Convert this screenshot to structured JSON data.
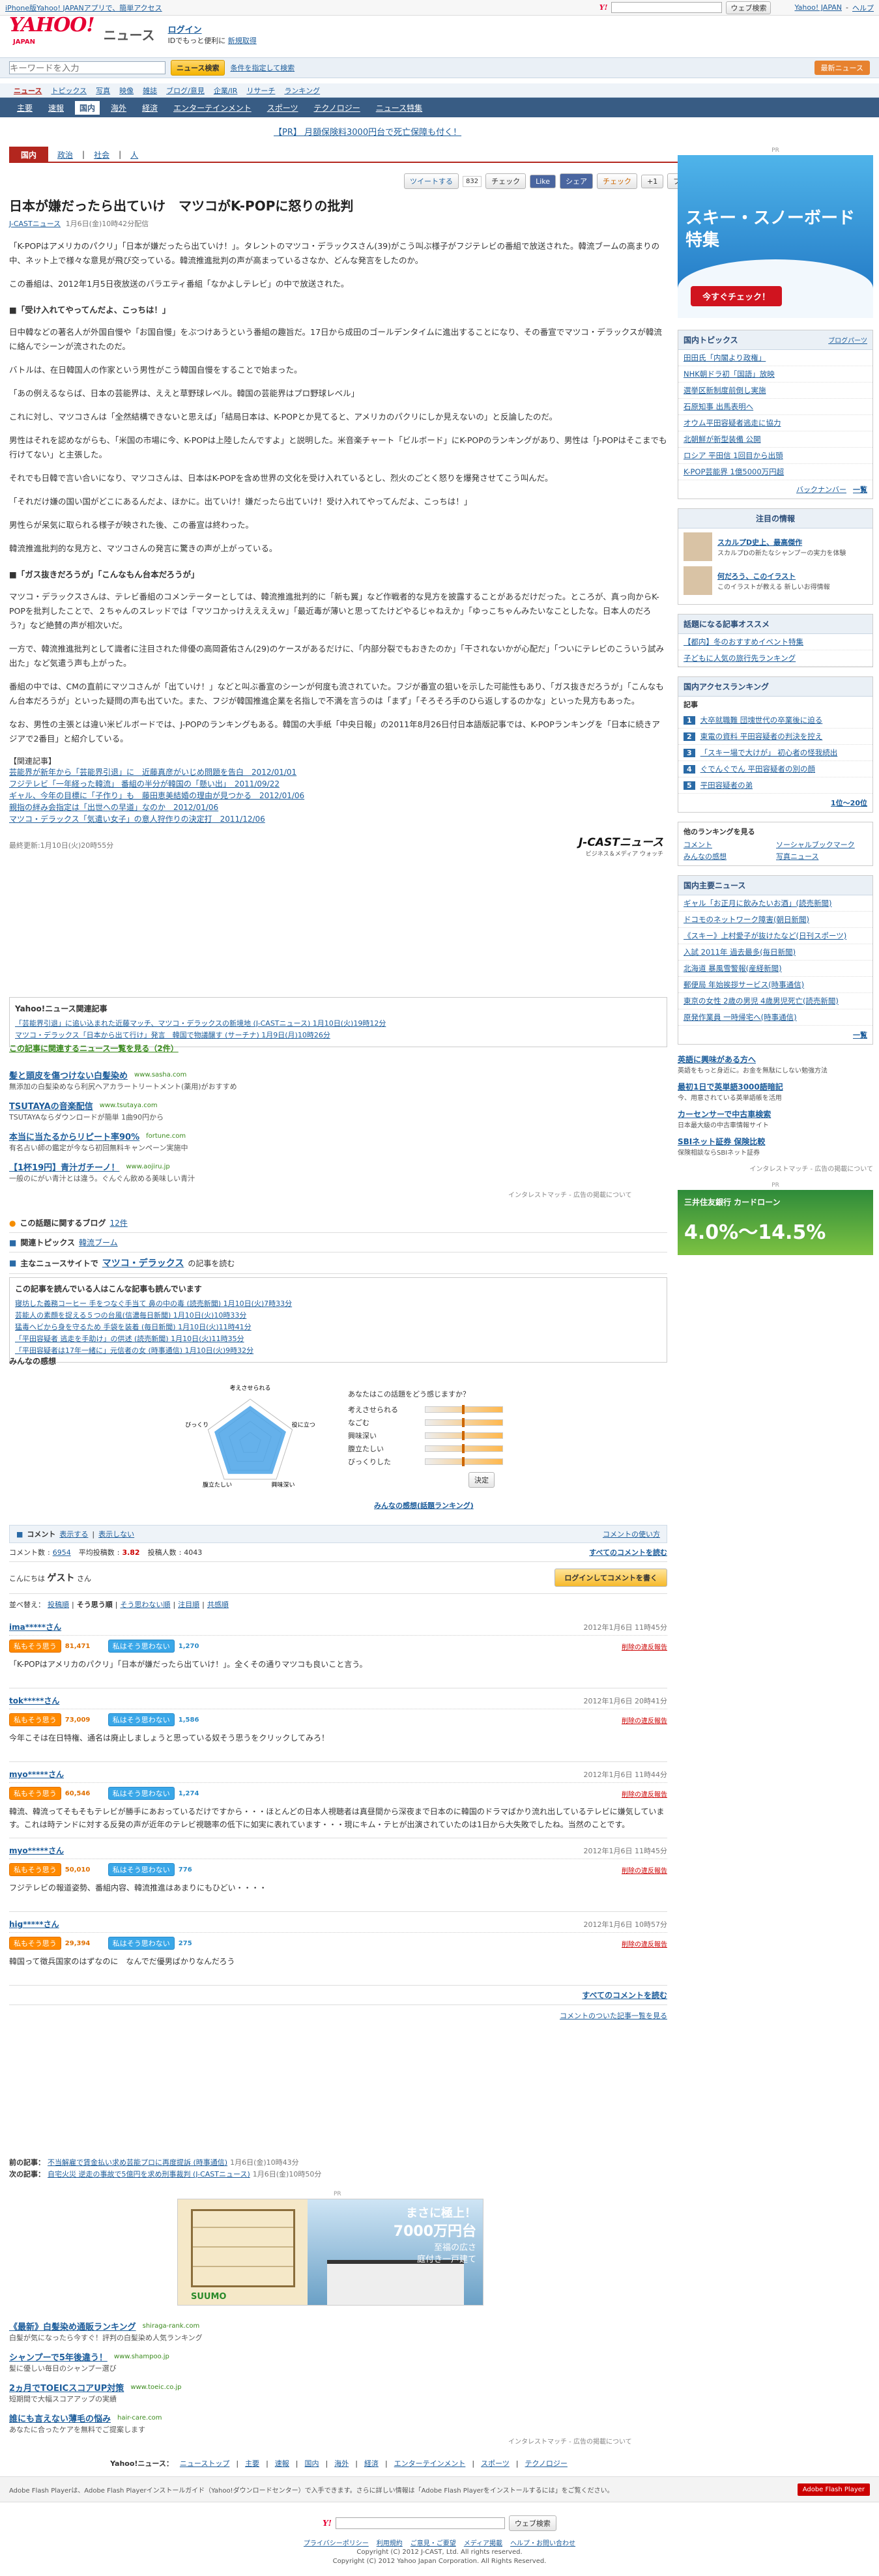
{
  "topbar": {
    "link": "iPhone版Yahoo! JAPANアプリで、簡単アクセス",
    "search_btn": "ウェブ検索",
    "right1": "Yahoo! JAPAN",
    "right2": "ヘルプ"
  },
  "header": {
    "logo": "YAHOO!",
    "logo_sub": "JAPAN",
    "service": "ニュース",
    "login": "ログイン",
    "login_sub": "IDでもっと便利に",
    "signup": "新規取得"
  },
  "search": {
    "placeholder": "キーワードを入力",
    "btn": "ニュース検索",
    "cond": "条件を指定して検索",
    "tag": "最新ニュース"
  },
  "nav1": [
    "ニュース",
    "トピックス",
    "写真",
    "映像",
    "雑誌",
    "ブログ/意見",
    "企業/IR",
    "リサーチ",
    "ランキング"
  ],
  "nav2": [
    "主要",
    "速報",
    "国内",
    "海外",
    "経済",
    "エンターテインメント",
    "スポーツ",
    "テクノロジー",
    "ニュース特集"
  ],
  "nav2_active": "国内",
  "pr_line": "【PR】 月額保険料3000円台で死亡保障も付く！",
  "cat": {
    "label": "国内",
    "sub1": "政治",
    "sub2": "社会",
    "sub3": "人"
  },
  "share": {
    "tweet": "ツイートする",
    "tweet_count": "832",
    "check": "チェック",
    "like": "Like",
    "share": "シェア",
    "mixi": "チェック",
    "g": "+1",
    "bookmark": "ブックマーク"
  },
  "article": {
    "title": "日本が嫌だったら出ていけ　マツコがK-POPに怒りの批判",
    "source": "J-CASTニュース",
    "time": "1月6日(金)10時42分配信",
    "p1": "「K-POPはアメリカのパクリ」「日本が嫌だったら出ていけ！」。タレントのマツコ・デラックスさん(39)がこう叫ぶ様子がフジテレビの番組で放送された。韓流ブームの高まりの中、ネット上で様々な意見が飛び交っている。韓流推進批判の声が高まっているさなか、どんな発言をしたのか。",
    "p2": "この番組は、2012年1月5日夜放送のバラエティ番組「なかよしテレビ」の中で放送された。",
    "h1": "■「受け入れてやってんだよ、こっちは！」",
    "p3": "日中韓などの著名人が外国自慢や「お国自慢」をぶつけあうという番組の趣旨だ。17日から成田のゴールデンタイムに進出することになり、その番宣でマツコ・デラックスが韓流に絡んでシーンが流されたのだ。",
    "p4": "バトルは、在日韓国人の作家という男性がこう韓国自慢をすることで始まった。",
    "p5": "「あの例えるならば、日本の芸能界は、ええと草野球レベル。韓国の芸能界はプロ野球レベル」",
    "p6": "これに対し、マツコさんは「全然結構できないと思えば」「結局日本は、K-POPとか見てると、アメリカのパクリにしか見えないの」と反論したのだ。",
    "p7": "男性はそれを認めながらも、「米国の市場に今、K-POPは上陸したんですよ」と説明した。米音楽チャート「ビルボード」にK-POPのランキングがあり、男性は「J-POPはそこまでも行けてない」と主張した。",
    "p8": "それでも日韓で言い合いになり、マツコさんは、日本はK-POPを含め世界の文化を受け入れているとし、烈火のごとく怒りを爆発させてこう叫んだ。",
    "p9": "「それだけ嫌の国い国がどこにあるんだよ、ほかに。出ていけ！嫌だったら出ていけ！受け入れてやってんだよ、こっちは！」",
    "p10": "男性らが呆気に取られる様子が映された後、この番宣は終わった。",
    "p11": "韓流推進批判的な見方と、マツコさんの発言に驚きの声が上がっている。",
    "h2": "■「ガス抜きだろうが」「こんなもん台本だろうが」",
    "p12": "マツコ・デラックスさんは、テレビ番組のコメンテーターとしては、韓流推進批判的に「新も翼」など作戦者的な見方を披露することがあるだけだった。ところが、真っ向からK-POPを批判したことで、２ちゃんのスレッドでは「マツコかっけええええｗ」「最近毒が薄いと思ってたけどやるじゃねえか」「ゆっこちゃんみたいなことしたな。日本人のだろう?」など絶賛の声が相次いだ。",
    "p13": "一方で、韓流推進批判として識者に注目された俳優の高岡蒼佑さん(29)のケースがあるだけに、「内部分裂でもおきたのか」「干されないかが心配だ」「ついにテレビのこういう試み出た」など気遣う声も上がった。",
    "p14": "番組の中では、CMの直前にマツコさんが「出ていけ！」などと叫ぶ番宣のシーンが何度も流されていた。フジが番宣の狙いを示した可能性もあり、「ガス抜きだろうが」「こんなもん台本だろうが」といった疑問の声も出ていた。また、フジが韓国推進企業を名指しで不満を言うのは「まず」「そろそろ手のひら返しするのかな」といった見方もあった。",
    "p15": "なお、男性の主張とは違い米ビルボードでは、J-POPのランキングもある。韓国の大手紙「中央日報」の2011年8月26日付日本語版記事では、K-POPランキングを「日本に続きアジアで2番目」と紹介している。",
    "rel_head": "【関連記事】",
    "rel": [
      "芸能界が新年から「芸能界引退」に　近藤真彦がいじめ問題を告白　2012/01/01",
      "フジテレビ「一年経った韓流」 番組の半分が韓国の「懸い出」　2011/09/22",
      "ギャル、今年の目標に「子作り」も　藤田恵美結婚の理由が見つかる　2012/01/06",
      "親指の絆み会指定は「出世への早道」なのか　2012/01/06",
      "マツコ・デラックス「気遣い女子」の意人狩作りの決定打　2011/12/06"
    ],
    "update": "最終更新:1月10日(火)20時55分",
    "jcast": "J-CASTニュース",
    "jcast_sub": "ビジネス＆メディア ウォッチ"
  },
  "related_box": {
    "title": "Yahoo!ニュース関連記事",
    "items": [
      "「芸能界引退」に追い込まれた近藤マッチ、マツコ・デラックスの新境地 (J-CASTニュース) 1月10日(火)19時12分",
      "マツコ・デラックス「日本から出て行け」発言　韓国で物議醸す (サーチナ) 1月9日(月)10時26分"
    ],
    "more": "この記事に関連するニュース一覧を見る（2件）"
  },
  "ads": [
    {
      "title": "髪と頭皮を傷つけない白髪染め",
      "url": "www.sasha.com",
      "desc": "無添加の白髪染めなら利尻ヘアカラートリートメント(薬用)がおすすめ"
    },
    {
      "title": "TSUTAYAの音楽配信",
      "url": "www.tsutaya.com",
      "desc": "TSUTAYAならダウンロードが簡単 1曲90円から"
    },
    {
      "title": "本当に当たるからリピート率90%",
      "url": "fortune.com",
      "desc": "有名占い師の鑑定が今なら初回無料キャンペーン実施中"
    },
    {
      "title": "【1杯19円】青汁ガチーノ！",
      "url": "www.aojiru.jp",
      "desc": "一般のにがい青汁とは違う。ぐんぐん飲める美味しい青汁"
    }
  ],
  "ads_note": "インタレストマッチ - 広告の掲載について",
  "blog": {
    "label": "この話題に関するブログ",
    "count": "12件"
  },
  "topic": {
    "label": "関連トピックス",
    "link": "韓流ブーム"
  },
  "people": {
    "label": "主なニュースサイトで",
    "link": "マツコ・デラックス",
    "suffix": "の記事を読む"
  },
  "also": {
    "title": "この記事を読んでいる人はこんな記事も読んでいます",
    "items": [
      "寝坊した義務コーヒー 手をつなぐ手当て 鼻の中の毒 (読売新聞) 1月10日(火)7時33分",
      "芸能人の素顔を捉える５つの台風(信濃毎日新聞) 1月10日(火)10時33分",
      "猛毒ヘビから身を守るため 手袋を装着 (毎日新聞) 1月10日(火)11時41分",
      "「平田容疑者 逃走を手助け」の供述 (読売新聞) 1月10日(火)11時35分",
      "「平田容疑者は17年一緒に」元信者の女 (時事通信) 1月10日(火)9時32分"
    ]
  },
  "feel": {
    "title": "みんなの感想",
    "q": "あなたはこの話題をどう感じますか？",
    "rows": [
      "考えさせられる",
      "なごむ",
      "興味深い",
      "腹立たしい",
      "びっくりした"
    ],
    "btn": "決定",
    "rank": "みんなの感想(話題ランキング)",
    "radar": [
      "考えさせられる",
      "役に立つ",
      "興味深い",
      "腹立たしい",
      "びっくり"
    ]
  },
  "comment": {
    "tab1": "コメント",
    "tab2": "表示する",
    "tab3": "表示しない",
    "help": "コメントの使い方",
    "label_count": "コメント数",
    "count": "6954",
    "label_avg": "平均投稿数",
    "avg": "3.82",
    "label_users": "投稿人数",
    "users": "4043",
    "all": "すべてのコメントを読む",
    "guest_pre": "こんにちは",
    "guest": "ゲスト",
    "guest_post": "さん",
    "login": "ログインしてコメントを書く",
    "sort": "並べ替え：",
    "sorts": [
      "投稿順",
      "そう思う順",
      "そう思わない順",
      "注目順",
      "共感順"
    ]
  },
  "comments": [
    {
      "user": "ima*****さん",
      "date": "2012年1月6日 11時45分",
      "agree": "81,471",
      "disagree": "1,270",
      "text": "「K-POPはアメリカのパクリ」「日本が嫌だったら出ていけ！」。全くその通りマツコも良いこと言う。"
    },
    {
      "user": "tok*****さん",
      "date": "2012年1月6日 20時41分",
      "agree": "73,009",
      "disagree": "1,586",
      "text": "今年こそは在日特権、通名は廃止しましょうと思っている奴そう思うをクリックしてみろ！"
    },
    {
      "user": "myo*****さん",
      "date": "2012年1月6日 11時44分",
      "agree": "60,546",
      "disagree": "1,274",
      "text": "韓流、韓流ってそもそもテレビが勝手にあおっているだけですから・・・ほとんどの日本人視聴者は真昼間から深夜まで日本のに韓国のドラマばかり流れ出しているテレビに嫌気しています。これは時テンドに対する反発の声が近年のテレビ視聴率の低下に如実に表れています・・・現にキム・テヒが出演されていたのは1日から大失敗でしたね。当然のことです。"
    },
    {
      "user": "myo*****さん",
      "date": "2012年1月6日 11時45分",
      "agree": "50,010",
      "disagree": "776",
      "text": "フジテレビの報道姿勢、番組内容、韓流推進はあまりにもひどい・・・・"
    },
    {
      "user": "hig*****さん",
      "date": "2012年1月6日 10時57分",
      "agree": "29,394",
      "disagree": "275",
      "text": "韓国って徴兵国家のはずなのに　なんでだ優男ばかりなんだろう"
    }
  ],
  "comment_btns": {
    "agree": "私もそう思う",
    "disagree": "私はそう思わない",
    "report": "削除の違反報告"
  },
  "read_all": "すべてのコメントを読む",
  "news_list_link": "コメントのついた記事一覧を見る",
  "prevnext": [
    {
      "label": "前の記事：",
      "text": "不当解雇で賃金払い求め芸能プロに再度提訴 (時事通信)",
      "time": "1月6日(金)10時43分"
    },
    {
      "label": "次の記事：",
      "text": "自宅火災 逆走の事故で5億円を求め刑事裁判 (J-CASTニュース)",
      "time": "1月6日(金)10時50分"
    }
  ],
  "ad_pr": "PR",
  "suumo": {
    "big": "まさに極上！",
    "price": "7000万円台",
    "sub": "至福の広さ",
    "sub2": "庭付き一戸建て",
    "brand": "SUUMO"
  },
  "ads2": [
    {
      "title": "《最新》白髪染め通販ランキング",
      "url": "shiraga-rank.com",
      "desc": "白髪が気になったら今すぐ！評判の白髪染め人気ランキング"
    },
    {
      "title": "シャンプーで5年後違う！",
      "url": "www.shampoo.jp",
      "desc": "髪に優しい毎日のシャンプー選び"
    },
    {
      "title": "2ヵ月でTOEICスコアUP対策",
      "url": "www.toeic.co.jp",
      "desc": "短期間で大幅スコアアップの実績"
    },
    {
      "title": "誰にも言えない薄毛の悩み",
      "url": "hair-care.com",
      "desc": "あなたに合ったケアを無料でご提案します"
    }
  ],
  "ads2_note": "インタレストマッチ - 広告の掲載について",
  "side": {
    "pr": "PR",
    "ski": "スキー・スノーボード特集",
    "ski_btn": "今すぐチェック！",
    "topics_title": "国内トピックス",
    "topics_sub": "ブログパーツ",
    "topics": [
      "田田氏「内閣より政権」",
      "NHK朝ドラ初「国語」放映",
      "選挙区新制度前倒し実施",
      "石原知事 出馬表明へ",
      "オウム平田容疑者逃走に協力",
      "北朝鮮が新型装備 公開",
      "ロシア 平田信 1回目から出頭",
      "K-POP芸能界 1億5000万円超"
    ],
    "topics_more": "一覧",
    "topics_backnum": "バックナンバー",
    "chumoku": "注目の情報",
    "chumoku_items": [
      {
        "t": "スカルプD史上、最高傑作",
        "d": "スカルプDの新たなシャンプーの実力を体験"
      },
      {
        "t": "何だろう、このイラスト",
        "d": "このイラストが教える 新しいお得情報"
      }
    ],
    "fav_title": "話題になる記事オススメ",
    "fav_items": [
      "【都内】冬のおすすめイベント特集",
      "子どもに人気の旅行先ランキング"
    ],
    "access_title": "国内アクセスランキング",
    "access_sub": "記事",
    "access": [
      "大卒就職難 団塊世代の卒業後に迫る",
      "東電の資料 平田容疑者の判決を控え",
      "「スキー場で大けが」 初心者の怪我続出",
      "ぐでんぐでん 平田容疑者の別の顔",
      "平田容疑者の弟"
    ],
    "access_more": "1位～20位",
    "rank_title": "他のランキングを見る",
    "rank_items": [
      "コメント",
      "ソーシャルブックマーク",
      "みんなの感想",
      "写真ニュース"
    ],
    "domestic_title": "国内主要ニュース",
    "domestic": [
      "ギャル「お正月に飲みたいお酒」(読売新聞)",
      "ドコモのネットワーク障害(朝日新聞)",
      "《スキー》上村愛子が抜けたなど(日刊スポーツ)",
      "入試 2011年 過去最多(毎日新聞)",
      "北海道 暴風雪警報(産経新聞)",
      "郵便局 年始挨拶サービス(時事通信)",
      "東京の女性 2歳の男児 4歳男児死亡(読売新聞)",
      "原発作業員 一時帰宅へ(時事通信)"
    ],
    "domestic_more": "一覧",
    "ads": [
      {
        "t": "英語に興味がある方へ",
        "d": "英語をもっと身近に。お金を無駄にしない勉強方法"
      },
      {
        "t": "最初1日で英単語3000語暗記",
        "d": "今、用意されている英単語帳を活用"
      },
      {
        "t": "カーセンサーで中古車検索",
        "d": "日本最大級の中古車情報サイト"
      },
      {
        "t": "SBIネット証券 保険比較",
        "d": "保険相談ならSBIネット証券"
      }
    ],
    "ads_note": "インタレストマッチ - 広告の掲載について",
    "bank_pr": "PR",
    "bank_name": "三井住友銀行 カードローン",
    "bank_rate": "4.0%～14.5%"
  },
  "footer": {
    "label": "Yahoo!ニュース：",
    "links": [
      "ニューストップ",
      "主要",
      "速報",
      "国内",
      "海外",
      "経済",
      "エンターテインメント",
      "スポーツ",
      "テクノロジー"
    ],
    "flash": "Adobe Flash Playerは、Adobe Flash Playerインストールガイド（Yahoo!ダウンロードセンター）で入手できます。さらに詳しい情報は「Adobe Flash Playerをインストールするには」をご覧ください。",
    "flash_badge": "Adobe Flash Player",
    "search_btn": "ウェブ検索",
    "links2": [
      "プライバシーポリシー",
      "利用規約",
      "ご意見・ご要望",
      "メディア掲載",
      "ヘルプ・お問い合わせ"
    ],
    "copy1": "Copyright (C) 2012 J-CAST, Ltd. All rights reserved.",
    "copy2": "Copyright (C) 2012 Yahoo Japan Corporation. All Rights Reserved."
  }
}
